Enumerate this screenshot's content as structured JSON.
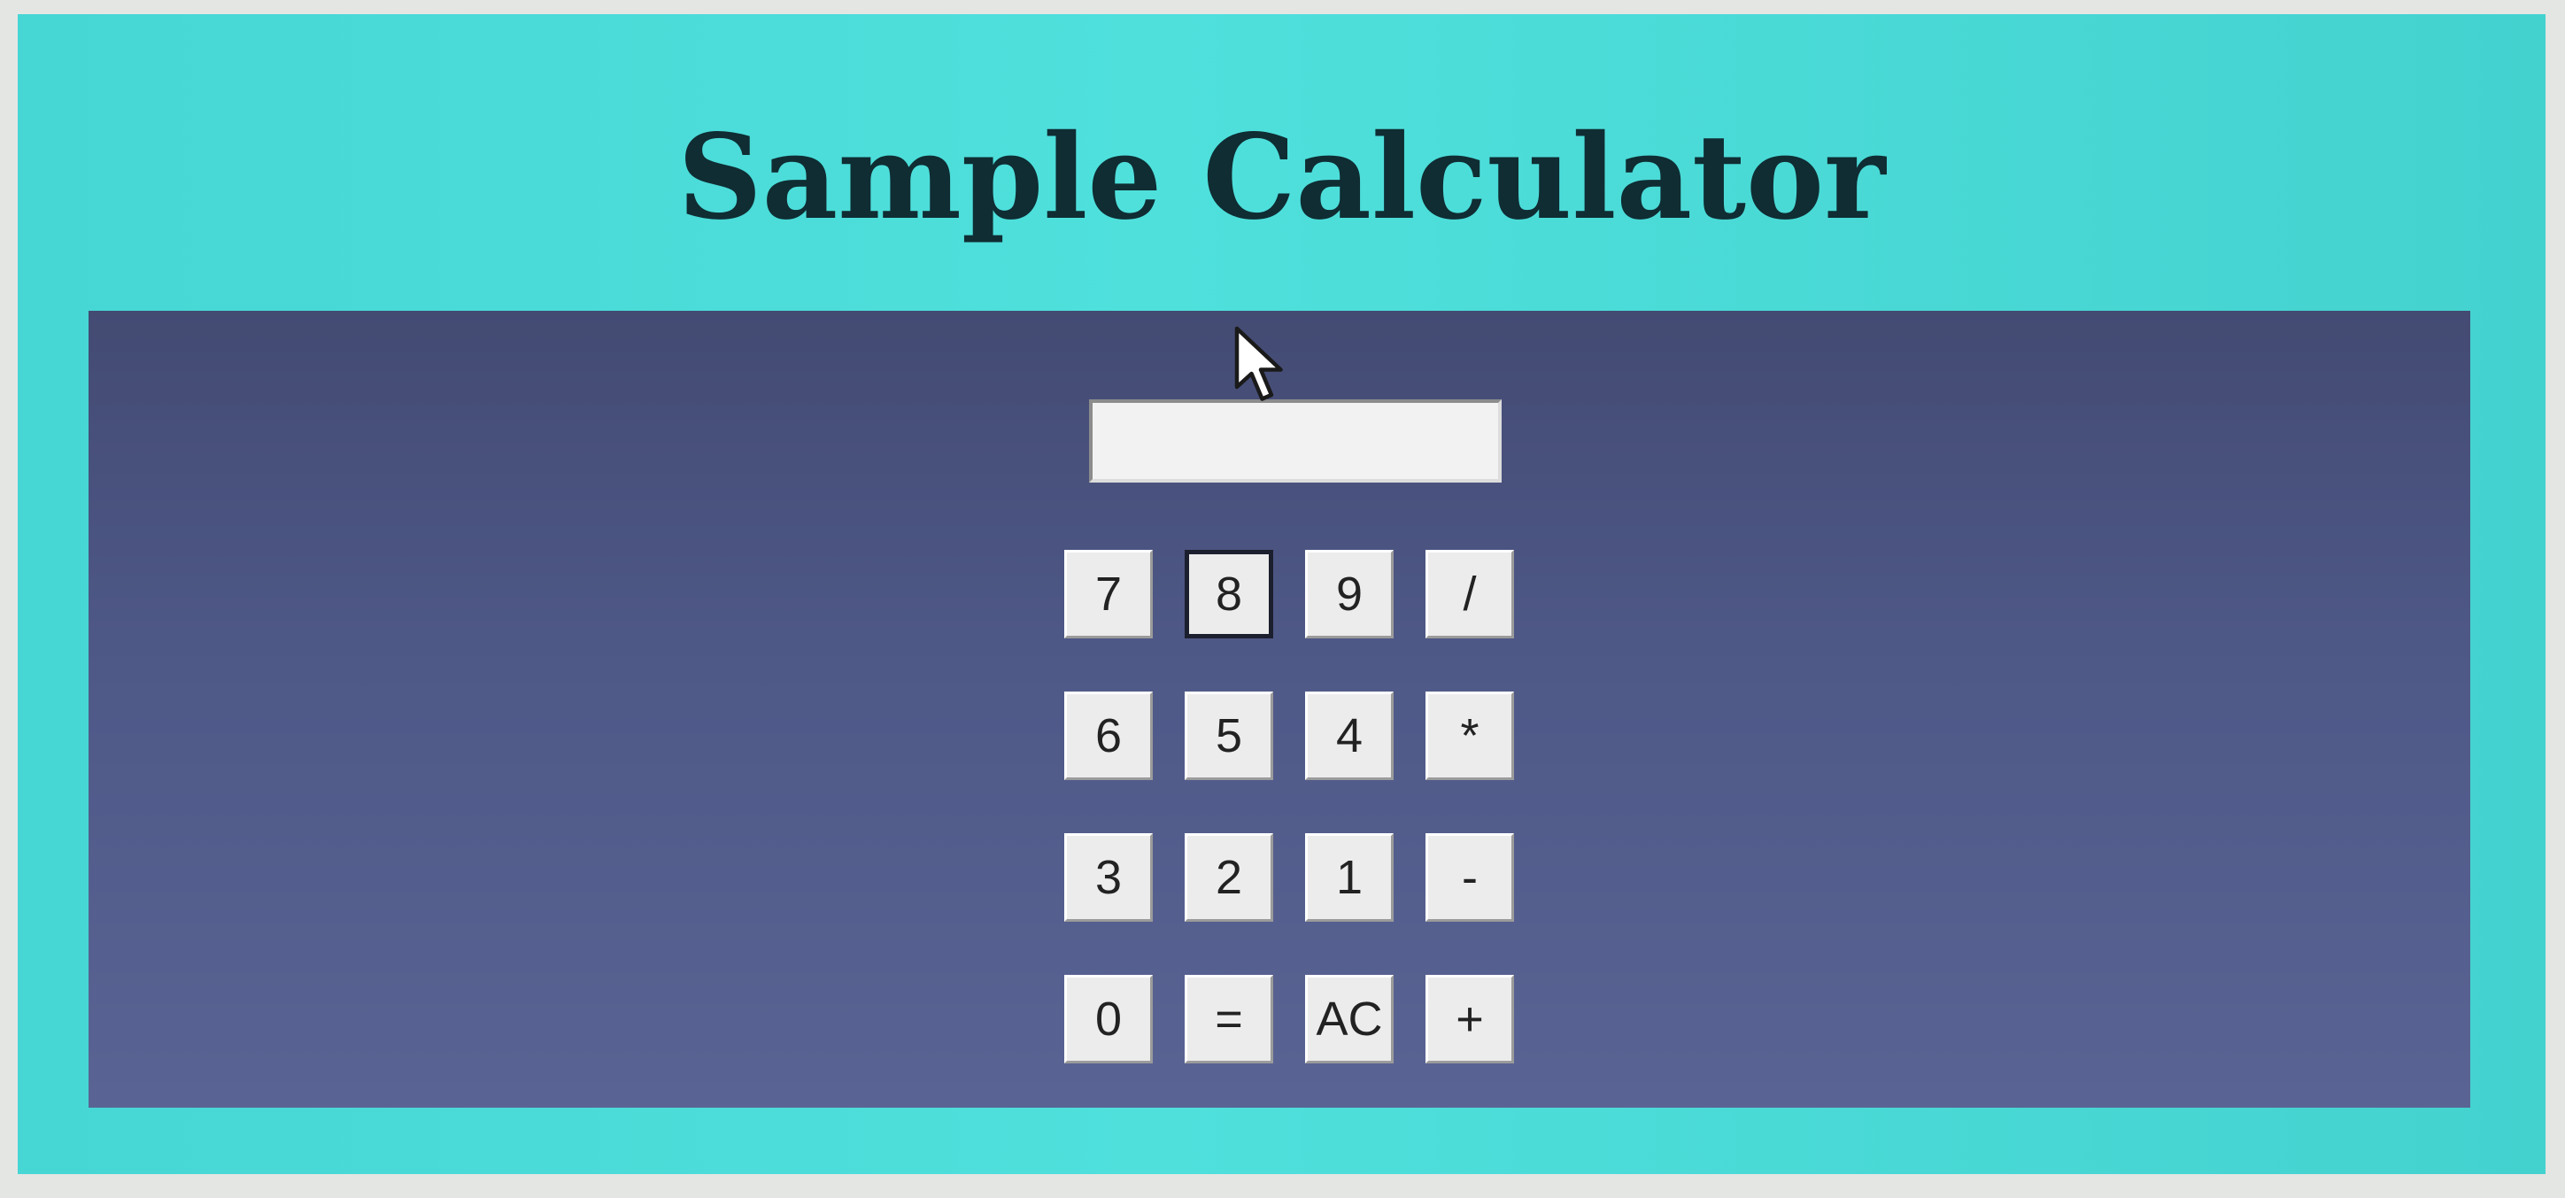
{
  "page": {
    "title": "Sample Calculator"
  },
  "display": {
    "value": ""
  },
  "keys": {
    "k7": "7",
    "k8": "8",
    "k9": "9",
    "kdiv": "/",
    "k6": "6",
    "k5": "5",
    "k4": "4",
    "kmul": "*",
    "k3": "3",
    "k2": "2",
    "k1": "1",
    "ksub": "-",
    "k0": "0",
    "keq": "=",
    "kac": "AC",
    "kadd": "+"
  },
  "colors": {
    "background": "#4fe0dc",
    "panel": "#4f5988",
    "title": "#0f2d33",
    "key": "#ececec"
  },
  "icons": {
    "cursor": "mouse-pointer-icon"
  }
}
